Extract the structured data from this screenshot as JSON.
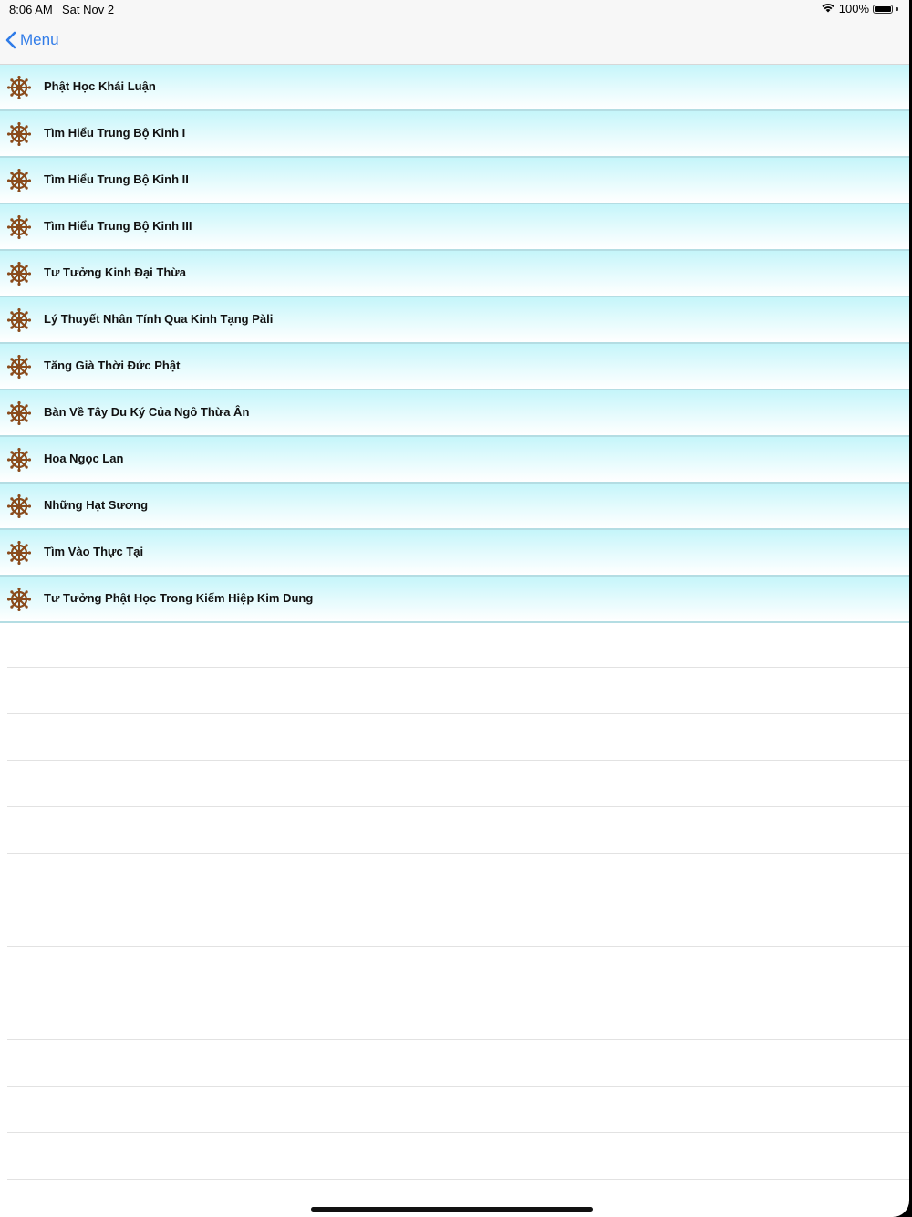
{
  "status_bar": {
    "time": "8:06 AM",
    "date": "Sat Nov 2",
    "battery": "100%"
  },
  "nav": {
    "back_label": "Menu"
  },
  "list": {
    "items": [
      {
        "label": "Phật Học Khái Luận",
        "icon": "dharma-wheel-icon"
      },
      {
        "label": "Tìm Hiểu Trung Bộ Kinh I",
        "icon": "dharma-wheel-icon"
      },
      {
        "label": "Tìm Hiểu Trung Bộ Kinh II",
        "icon": "dharma-wheel-icon"
      },
      {
        "label": "Tìm Hiểu Trung Bộ Kinh III",
        "icon": "dharma-wheel-icon"
      },
      {
        "label": "Tư Tưởng Kinh Đại Thừa",
        "icon": "dharma-wheel-icon"
      },
      {
        "label": "Lý Thuyết Nhân Tính Qua Kinh Tạng Pàli",
        "icon": "dharma-wheel-icon"
      },
      {
        "label": "Tăng Già Thời Đức Phật",
        "icon": "dharma-wheel-icon"
      },
      {
        "label": "Bàn Về Tây Du Ký Của Ngô Thừa Ân",
        "icon": "dharma-wheel-icon"
      },
      {
        "label": "Hoa Ngọc Lan",
        "icon": "dharma-wheel-icon"
      },
      {
        "label": "Những Hạt Sương",
        "icon": "dharma-wheel-icon"
      },
      {
        "label": "Tìm Vào Thực Tại",
        "icon": "dharma-wheel-icon"
      },
      {
        "label": "Tư Tưởng Phật Học Trong Kiếm Hiệp Kim Dung",
        "icon": "dharma-wheel-icon"
      }
    ]
  },
  "colors": {
    "accent": "#2f7be8",
    "row_top": "#c5f5fa",
    "row_separator": "#b4dde3",
    "icon_brown": "#8a4b1c"
  }
}
